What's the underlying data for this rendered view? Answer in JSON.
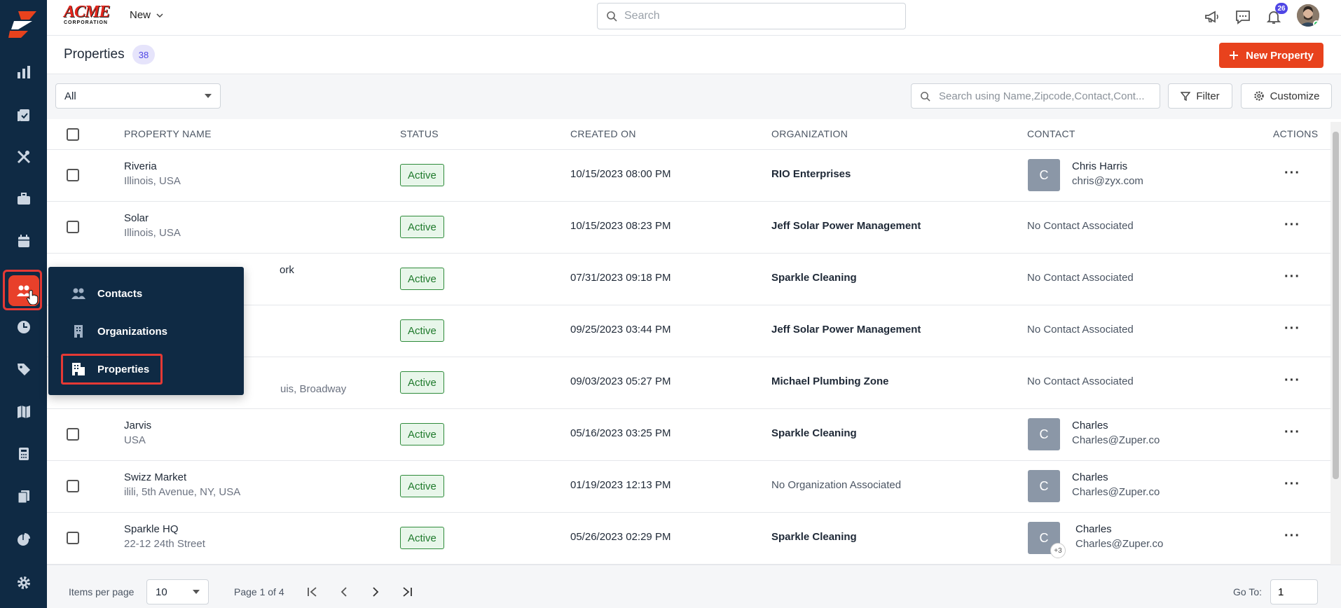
{
  "topbar": {
    "brand_word": "ACME",
    "brand_sub": "CORPORATION",
    "new_label": "New",
    "search_placeholder": "Search",
    "notification_count": "26"
  },
  "page": {
    "title": "Properties",
    "count": "38",
    "new_button": "New Property"
  },
  "toolbar": {
    "view_select": "All",
    "search_placeholder": "Search using Name,Zipcode,Contact,Cont...",
    "filter_label": "Filter",
    "customize_label": "Customize"
  },
  "table": {
    "headers": {
      "name": "PROPERTY NAME",
      "status": "STATUS",
      "created": "CREATED ON",
      "organization": "ORGANIZATION",
      "contact": "CONTACT",
      "actions": "ACTIONS"
    },
    "rows": [
      {
        "name": "Riveria",
        "address": "Illinois, USA",
        "status": "Active",
        "created": "10/15/2023 08:00 PM",
        "org": "RIO Enterprises",
        "contact_initial": "C",
        "contact_name": "Chris Harris",
        "contact_email": "chris@zyx.com"
      },
      {
        "name": "Solar",
        "address": "Illinois, USA",
        "status": "Active",
        "created": "10/15/2023 08:23 PM",
        "org": "Jeff Solar Power Management",
        "contact_none": "No Contact Associated"
      },
      {
        "name": "ork",
        "address": "",
        "status": "Active",
        "created": "07/31/2023 09:18 PM",
        "org": "Sparkle Cleaning",
        "contact_none": "No Contact Associated"
      },
      {
        "name": "",
        "address": "",
        "status": "Active",
        "created": "09/25/2023 03:44 PM",
        "org": "Jeff Solar Power Management",
        "contact_none": "No Contact Associated"
      },
      {
        "name": "",
        "address": "uis, Broadway",
        "status": "Active",
        "created": "09/03/2023 05:27 PM",
        "org": "Michael Plumbing Zone",
        "contact_none": "No Contact Associated"
      },
      {
        "name": "Jarvis",
        "address": "USA",
        "status": "Active",
        "created": "05/16/2023 03:25 PM",
        "org": "Sparkle Cleaning",
        "contact_initial": "C",
        "contact_name": "Charles",
        "contact_email": "Charles@Zuper.co"
      },
      {
        "name": "Swizz Market",
        "address": "ilili, 5th Avenue, NY, USA",
        "status": "Active",
        "created": "01/19/2023 12:13 PM",
        "org": "No Organization Associated",
        "contact_initial": "C",
        "contact_name": "Charles",
        "contact_email": "Charles@Zuper.co"
      },
      {
        "name": "Sparkle HQ",
        "address": "22-12 24th Street",
        "status": "Active",
        "created": "05/26/2023 02:29 PM",
        "org": "Sparkle Cleaning",
        "contact_initial": "C",
        "contact_extra": "+3",
        "contact_name": "Charles",
        "contact_email": "Charles@Zuper.co"
      }
    ]
  },
  "footer": {
    "items_per_page_label": "Items per page",
    "items_per_page": "10",
    "page_info": "Page 1 of 4",
    "goto_label": "Go To:",
    "goto_value": "1"
  },
  "flyout": {
    "items": [
      {
        "label": "Contacts",
        "icon": "people-icon"
      },
      {
        "label": "Organizations",
        "icon": "building-icon"
      },
      {
        "label": "Properties",
        "icon": "property-icon"
      }
    ]
  },
  "colors": {
    "rail_bg": "#0f2a44",
    "accent": "#e8421d",
    "status_green": "#1f7a2c",
    "badge_purple": "#4f46e5"
  }
}
